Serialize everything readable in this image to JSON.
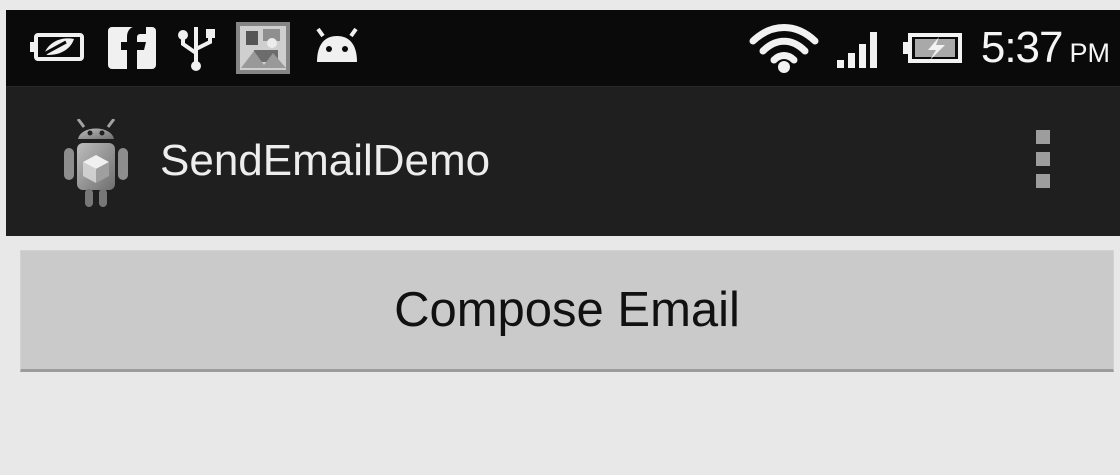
{
  "status_bar": {
    "time": "5:37",
    "ampm": "PM",
    "left_icons": [
      "battery-saver-icon",
      "facebook-icon",
      "usb-icon",
      "photo-thumbnail-icon",
      "android-icon"
    ],
    "right_icons": [
      "wifi-icon",
      "signal-icon",
      "battery-charging-icon"
    ]
  },
  "action_bar": {
    "app_title": "SendEmailDemo",
    "app_icon": "android-app-icon",
    "overflow_icon": "overflow-menu-icon"
  },
  "main": {
    "compose_button_label": "Compose Email"
  },
  "colors": {
    "status_bar_bg": "#0a0a0a",
    "action_bar_bg": "#1f1f1f",
    "content_bg": "#e8e8e8",
    "button_bg": "#cacaca"
  }
}
